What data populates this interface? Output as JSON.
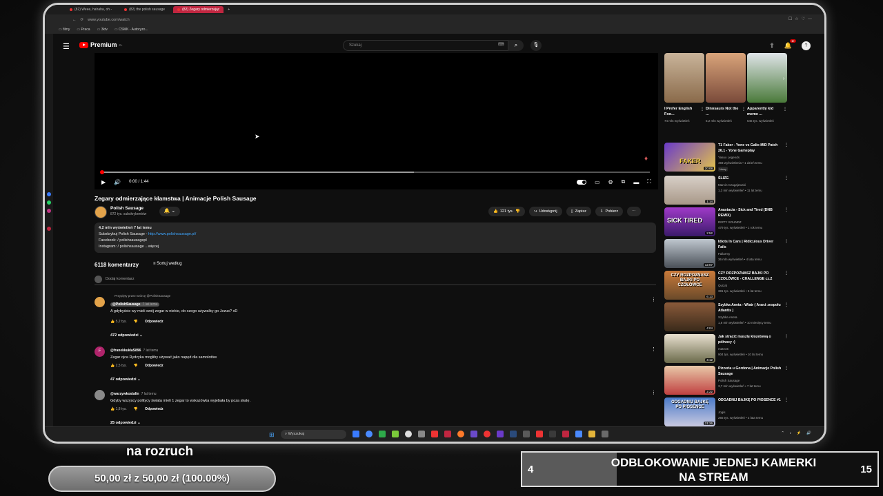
{
  "browser": {
    "tabs": [
      "(82) Weee, hahaha, oh -",
      "(82) the polish sausage",
      "(82) Zegary odmierzając"
    ],
    "url": "www.youtube.com/watch",
    "bookmarks": [
      "filmy",
      "Praca",
      "3ktv",
      "CSMK - Autoryzo..."
    ]
  },
  "youtube": {
    "logo_text": "Premium",
    "logo_sup": "PL",
    "search_placeholder": "Szukaj",
    "notifications_badge": "9+"
  },
  "player": {
    "time": "0:00 / 1:44",
    "progress_loaded": 0.57,
    "progress_played": 0.0
  },
  "video": {
    "title": "Zegary odmierzające kłamstwa | Animacje Polish Sausage",
    "channel": "Polish Sausage",
    "subscribers": "872 tys. subskrybentów",
    "likes": "121 tys.",
    "share": "Udostępnij",
    "save": "Zapisz",
    "download": "Pobierz",
    "desc_stats": "4,2 mln wyświetleń  7 lat temu",
    "desc_line2_prefix": "Subskrybuj Polish Sausage - ",
    "desc_link": "http://www.polishsausage.pl/",
    "desc_line3": "Facebook: / polishsausagepl",
    "desc_line4": "Instagram: / polishsausage  ...więcej"
  },
  "comments": {
    "count": "6118 komentarzy",
    "sort": "Sortuj według",
    "add": "Dodaj komentarz",
    "reply_label": "Odpowiedz",
    "items": [
      {
        "pinned": "Przypięty przez twórcę @PolishSausage",
        "author": "@PolishSausage",
        "ago": "7 lat temu",
        "text": "A gdybyście wy mieli swój zegar w niebie, do czego używalby go Jezus? xD",
        "likes": "5,2 tys.",
        "replies": "472 odpowiedzi"
      },
      {
        "author": "@franekkuklaS896",
        "ago": "7 lat temu",
        "text": "Zegar ojca Rydzyka mogliby używać jako napęd dla samolotów",
        "likes": "2,5 tys.",
        "replies": "47 odpowiedzi"
      },
      {
        "author": "@warzywkostalin",
        "ago": "7 lat temu",
        "text": "Gdyby wszyscy politycy świata mieli 1 zegar to wskazówka wyjebała by poza skalę.",
        "likes": "1,8 tys.",
        "replies": "25 odpowiedzi"
      }
    ]
  },
  "shorts": [
    {
      "title": "I Prefer English Foo...",
      "views": "74 mln wyświetleń"
    },
    {
      "title": "Dinosaurs Not the ...",
      "views": "5,2 mln wyświetleń"
    },
    {
      "title": "Apparently kid meme ...",
      "views": "646 tys. wyświetleń"
    }
  ],
  "recommendations": [
    {
      "title": "T1 Faker - Yone vs Galio MID Patch 26.1 - Yone Gameplay",
      "channel": "Yasuo Legends",
      "views": "493 wyświetlenia • 1 dzień temu",
      "duration": "20:08",
      "badge": "Nowy",
      "thumb_text": "FAKER"
    },
    {
      "title": "ŚLIZG",
      "channel": "Marcin Czagajewski",
      "views": "1,3 mln wyświetleń • 11 lat temu",
      "duration": "1:14",
      "thumb_text": ""
    },
    {
      "title": "Anastacia - Sick and Tired (DNB REMIX)",
      "channel": "DIRTY SOUNDZ",
      "views": "479 tys. wyświetleń • 1 rok temu",
      "duration": "2:52",
      "thumb_text": "SICK  TIRED"
    },
    {
      "title": "Idiots In Cars | Ridiculous Driver Fails",
      "channel": "Failarmy",
      "views": "36 mln wyświetleń • 4 lata temu",
      "duration": "12:07",
      "thumb_text": ""
    },
    {
      "title": "CZY ROZPOZNASZ BAJKI PO CZOŁÓWCE - CHALLENGE cz.2",
      "channel": "Quizat",
      "views": "381 tys. wyświetleń • 5 lat temu",
      "duration": "6:13",
      "thumb_text": "CZY ROZPOZNASZ BAJKI PO CZOŁÓWCE"
    },
    {
      "title": "Szybka Aneta - Wiatr ( Aranż zespołu Atlantis )",
      "channel": "Szybka Aneta",
      "views": "1,6 mln wyświetleń • 10 miesięcy temu",
      "duration": "4:04",
      "thumb_text": ""
    },
    {
      "title": "Jak stracić muszlę klozetową o północy :)",
      "channel": "mateo5",
      "views": "904 tys. wyświetleń • 10 lat temu",
      "duration": "4:12",
      "thumb_text": ""
    },
    {
      "title": "Pizzeria u Gordona | Animacje Polish Sausage",
      "channel": "Polish Sausage",
      "views": "3,7 mln wyświetleń • 7 lat temu",
      "duration": "2:22",
      "thumb_text": ""
    },
    {
      "title": "ODGADNIJ BAJKĘ PO PIOSENCE #1",
      "channel": "Jogis",
      "views": "265 tys. wyświetleń • 2 lata temu",
      "duration": "21:26",
      "thumb_text": "ODGADNIJ BAJKĘ PO PIOSENCE"
    }
  ],
  "taskbar": {
    "search": "Wyszukaj"
  },
  "overlay": {
    "goal_label": "na rozruch",
    "goal_amount": "50,00 zł z 50,00 zł (100.00%)",
    "reward_current": "4",
    "reward_goal": "15",
    "reward_line1": "ODBLOKOWANIE JEDNEJ KAMERKI",
    "reward_line2": "NA STREAM"
  },
  "colors": {
    "accent": "#ff0000",
    "link": "#3ea6ff",
    "tab_active": "#c02640"
  }
}
